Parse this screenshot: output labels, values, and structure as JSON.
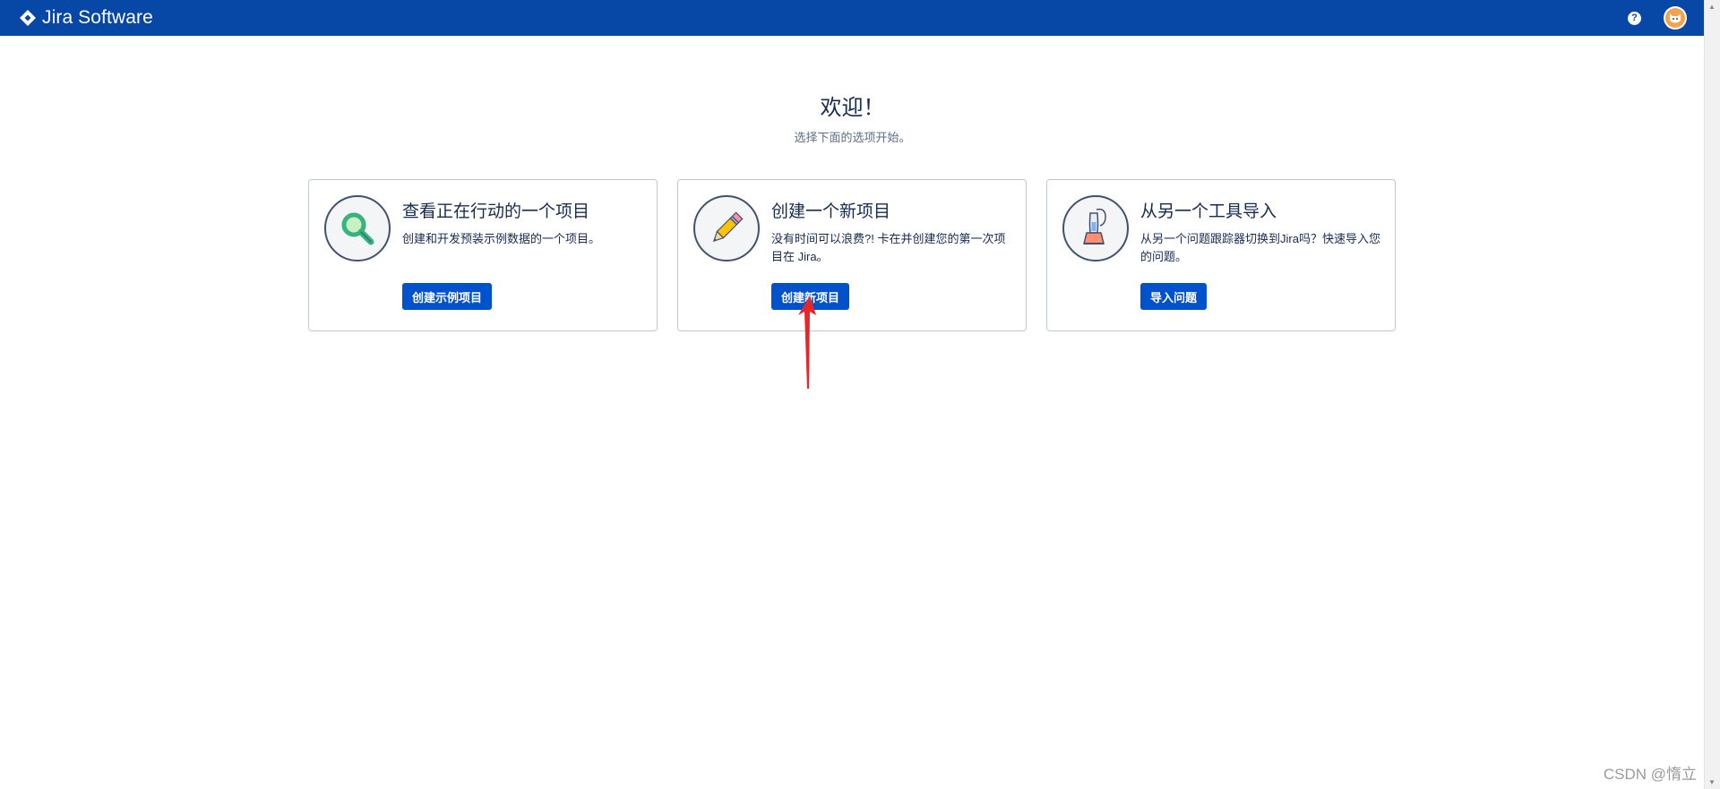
{
  "header": {
    "app_name": "Jira Software",
    "help_icon": "question-circle-icon",
    "help_glyph": "?",
    "avatar_icon": "user-avatar-icon"
  },
  "main": {
    "title": "欢迎！",
    "subtitle": "选择下面的选项开始。"
  },
  "cards": [
    {
      "icon": "magnifier-icon",
      "title": "查看正在行动的一个项目",
      "description": "创建和开发预装示例数据的一个项目。",
      "button": "创建示例项目"
    },
    {
      "icon": "pencil-icon",
      "title": "创建一个新项目",
      "description": "没有时间可以浪费?! 卡在并创建您的第一次项目在 Jira。",
      "button": "创建新项目"
    },
    {
      "icon": "vacuum-icon",
      "title": "从另一个工具导入",
      "description": "从另一个问题跟踪器切换到Jira吗？快速导入您的问题。",
      "button": "导入问题"
    }
  ],
  "annotation": {
    "icon": "red-arrow-icon",
    "color": "#e8262a"
  },
  "watermark": "CSDN @惰立",
  "colors": {
    "brand": "#0747a6",
    "button": "#0052cc"
  }
}
